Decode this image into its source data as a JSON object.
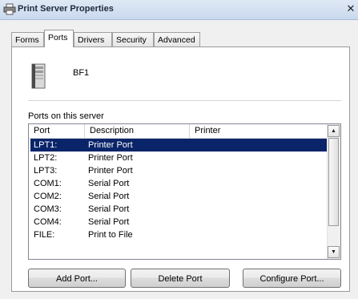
{
  "window": {
    "title": "Print Server Properties",
    "close_glyph": "✕"
  },
  "tabs": [
    {
      "label": "Forms"
    },
    {
      "label": "Ports"
    },
    {
      "label": "Drivers"
    },
    {
      "label": "Security"
    },
    {
      "label": "Advanced"
    }
  ],
  "active_tab": "Ports",
  "server": {
    "name": "BF1",
    "icon": "server-tower-icon"
  },
  "ports_section": {
    "label": "Ports on this server",
    "columns": [
      "Port",
      "Description",
      "Printer"
    ],
    "rows": [
      {
        "port": "LPT1:",
        "description": "Printer Port",
        "printer": ""
      },
      {
        "port": "LPT2:",
        "description": "Printer Port",
        "printer": ""
      },
      {
        "port": "LPT3:",
        "description": "Printer Port",
        "printer": ""
      },
      {
        "port": "COM1:",
        "description": "Serial Port",
        "printer": ""
      },
      {
        "port": "COM2:",
        "description": "Serial Port",
        "printer": ""
      },
      {
        "port": "COM3:",
        "description": "Serial Port",
        "printer": ""
      },
      {
        "port": "COM4:",
        "description": "Serial Port",
        "printer": ""
      },
      {
        "port": "FILE:",
        "description": "Print to File",
        "printer": ""
      }
    ],
    "selected_row": "LPT1:"
  },
  "buttons": {
    "add_port": "Add Port...",
    "delete_port": "Delete Port",
    "configure_port": "Configure Port..."
  },
  "colors": {
    "selection": "#0a246a",
    "titlebar": "#c9d9ee"
  }
}
